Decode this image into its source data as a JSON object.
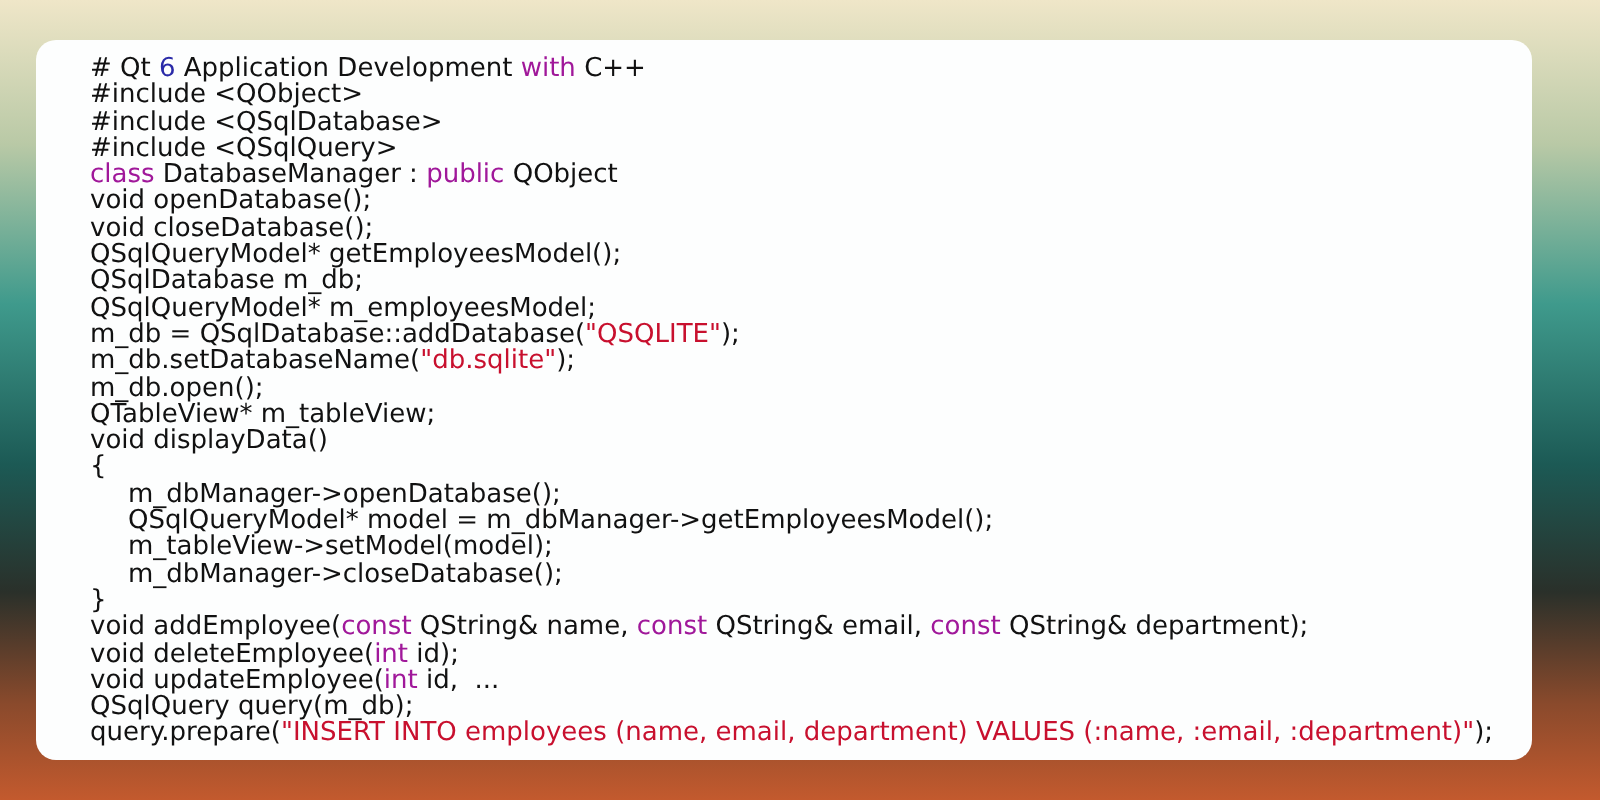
{
  "code": {
    "lines": [
      {
        "segments": [
          {
            "kind": "plain",
            "text": "# Qt "
          },
          {
            "kind": "number",
            "text": "6"
          },
          {
            "kind": "plain",
            "text": " Application Development "
          },
          {
            "kind": "keyword",
            "text": "with"
          },
          {
            "kind": "plain",
            "text": " C++"
          }
        ]
      },
      {
        "segments": [
          {
            "kind": "plain",
            "text": "#include <QObject>"
          }
        ]
      },
      {
        "segments": [
          {
            "kind": "plain",
            "text": "#include <QSqlDatabase>"
          }
        ]
      },
      {
        "segments": [
          {
            "kind": "plain",
            "text": "#include <QSqlQuery>"
          }
        ]
      },
      {
        "segments": [
          {
            "kind": "keyword",
            "text": "class"
          },
          {
            "kind": "plain",
            "text": " DatabaseManager : "
          },
          {
            "kind": "keyword",
            "text": "public"
          },
          {
            "kind": "plain",
            "text": " QObject"
          }
        ]
      },
      {
        "segments": [
          {
            "kind": "plain",
            "text": "void openDatabase();"
          }
        ]
      },
      {
        "segments": [
          {
            "kind": "plain",
            "text": "void closeDatabase();"
          }
        ]
      },
      {
        "segments": [
          {
            "kind": "plain",
            "text": "QSqlQueryModel* getEmployeesModel();"
          }
        ]
      },
      {
        "segments": [
          {
            "kind": "plain",
            "text": "QSqlDatabase m_db;"
          }
        ]
      },
      {
        "segments": [
          {
            "kind": "plain",
            "text": "QSqlQueryModel* m_employeesModel;"
          }
        ]
      },
      {
        "segments": [
          {
            "kind": "plain",
            "text": "m_db = QSqlDatabase::addDatabase("
          },
          {
            "kind": "string",
            "text": "\"QSQLITE\""
          },
          {
            "kind": "plain",
            "text": ");"
          }
        ]
      },
      {
        "segments": [
          {
            "kind": "plain",
            "text": "m_db.setDatabaseName("
          },
          {
            "kind": "string",
            "text": "\"db.sqlite\""
          },
          {
            "kind": "plain",
            "text": ");"
          }
        ]
      },
      {
        "segments": [
          {
            "kind": "plain",
            "text": "m_db.open();"
          }
        ]
      },
      {
        "segments": [
          {
            "kind": "plain",
            "text": "QTableView* m_tableView;"
          }
        ]
      },
      {
        "segments": [
          {
            "kind": "plain",
            "text": "void displayData()"
          }
        ]
      },
      {
        "segments": [
          {
            "kind": "plain",
            "text": "{"
          }
        ],
        "children": [
          {
            "segments": [
              {
                "kind": "plain",
                "text": "m_dbManager->openDatabase();"
              }
            ]
          },
          {
            "segments": [
              {
                "kind": "plain",
                "text": "QSqlQueryModel* model = m_dbManager->getEmployeesModel();"
              }
            ]
          },
          {
            "segments": [
              {
                "kind": "plain",
                "text": "m_tableView->setModel(model);"
              }
            ]
          },
          {
            "segments": [
              {
                "kind": "plain",
                "text": "m_dbManager->closeDatabase();"
              }
            ]
          }
        ]
      },
      {
        "segments": [
          {
            "kind": "plain",
            "text": "}"
          }
        ]
      },
      {
        "segments": [
          {
            "kind": "plain",
            "text": "void addEmployee("
          },
          {
            "kind": "keyword",
            "text": "const"
          },
          {
            "kind": "plain",
            "text": " QString& name, "
          },
          {
            "kind": "keyword",
            "text": "const"
          },
          {
            "kind": "plain",
            "text": " QString& email, "
          },
          {
            "kind": "keyword",
            "text": "const"
          },
          {
            "kind": "plain",
            "text": " QString& department);"
          }
        ]
      },
      {
        "segments": [
          {
            "kind": "plain",
            "text": "void deleteEmployee("
          },
          {
            "kind": "keyword",
            "text": "int"
          },
          {
            "kind": "plain",
            "text": " id);"
          }
        ]
      },
      {
        "segments": [
          {
            "kind": "plain",
            "text": "void updateEmployee("
          },
          {
            "kind": "keyword",
            "text": "int"
          },
          {
            "kind": "plain",
            "text": " id,  ..."
          }
        ]
      },
      {
        "segments": [
          {
            "kind": "plain",
            "text": "QSqlQuery query(m_db);"
          }
        ]
      },
      {
        "segments": [
          {
            "kind": "plain",
            "text": "query.prepare("
          },
          {
            "kind": "string",
            "text": "\"INSERT INTO employees (name, email, department) VALUES (:name, :email, :department)\""
          },
          {
            "kind": "plain",
            "text": ");"
          }
        ]
      }
    ]
  }
}
